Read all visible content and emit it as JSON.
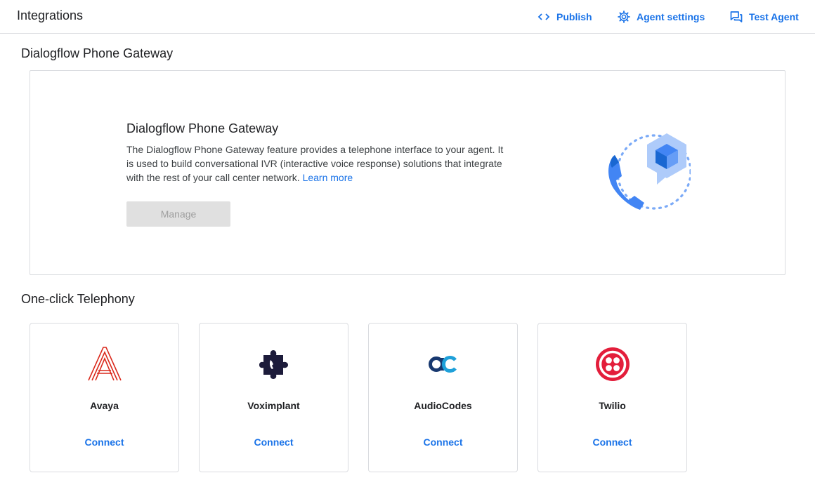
{
  "header": {
    "title": "Integrations",
    "actions": [
      {
        "label": "Publish",
        "icon": "code-icon"
      },
      {
        "label": "Agent settings",
        "icon": "gear-icon"
      },
      {
        "label": "Test Agent",
        "icon": "chat-icon"
      }
    ]
  },
  "gateway_section": {
    "heading": "Dialogflow Phone Gateway",
    "card": {
      "title": "Dialogflow Phone Gateway",
      "description": "The Dialogflow Phone Gateway feature provides a telephone interface to your agent. It is used to build conversational IVR (interactive voice response) solutions that integrate with the rest of your call center network.",
      "link": "Learn more",
      "button": "Manage",
      "illustration": "phone-gateway-illustration"
    }
  },
  "telephony_section": {
    "heading": "One-click Telephony",
    "providers": [
      {
        "name": "Avaya",
        "action": "Connect",
        "icon": "avaya-logo-icon",
        "color": "#da291c"
      },
      {
        "name": "Voximplant",
        "action": "Connect",
        "icon": "voximplant-logo-icon",
        "color": "#1c1b3a"
      },
      {
        "name": "AudioCodes",
        "action": "Connect",
        "icon": "audiocodes-logo-icon",
        "color": "#17386f"
      },
      {
        "name": "Twilio",
        "action": "Connect",
        "icon": "twilio-logo-icon",
        "color": "#e31e3b"
      }
    ]
  },
  "colors": {
    "accent": "#1a73e8",
    "border": "#dadce0",
    "disabled_bg": "#e0e0e0",
    "disabled_text": "#9e9e9e"
  }
}
